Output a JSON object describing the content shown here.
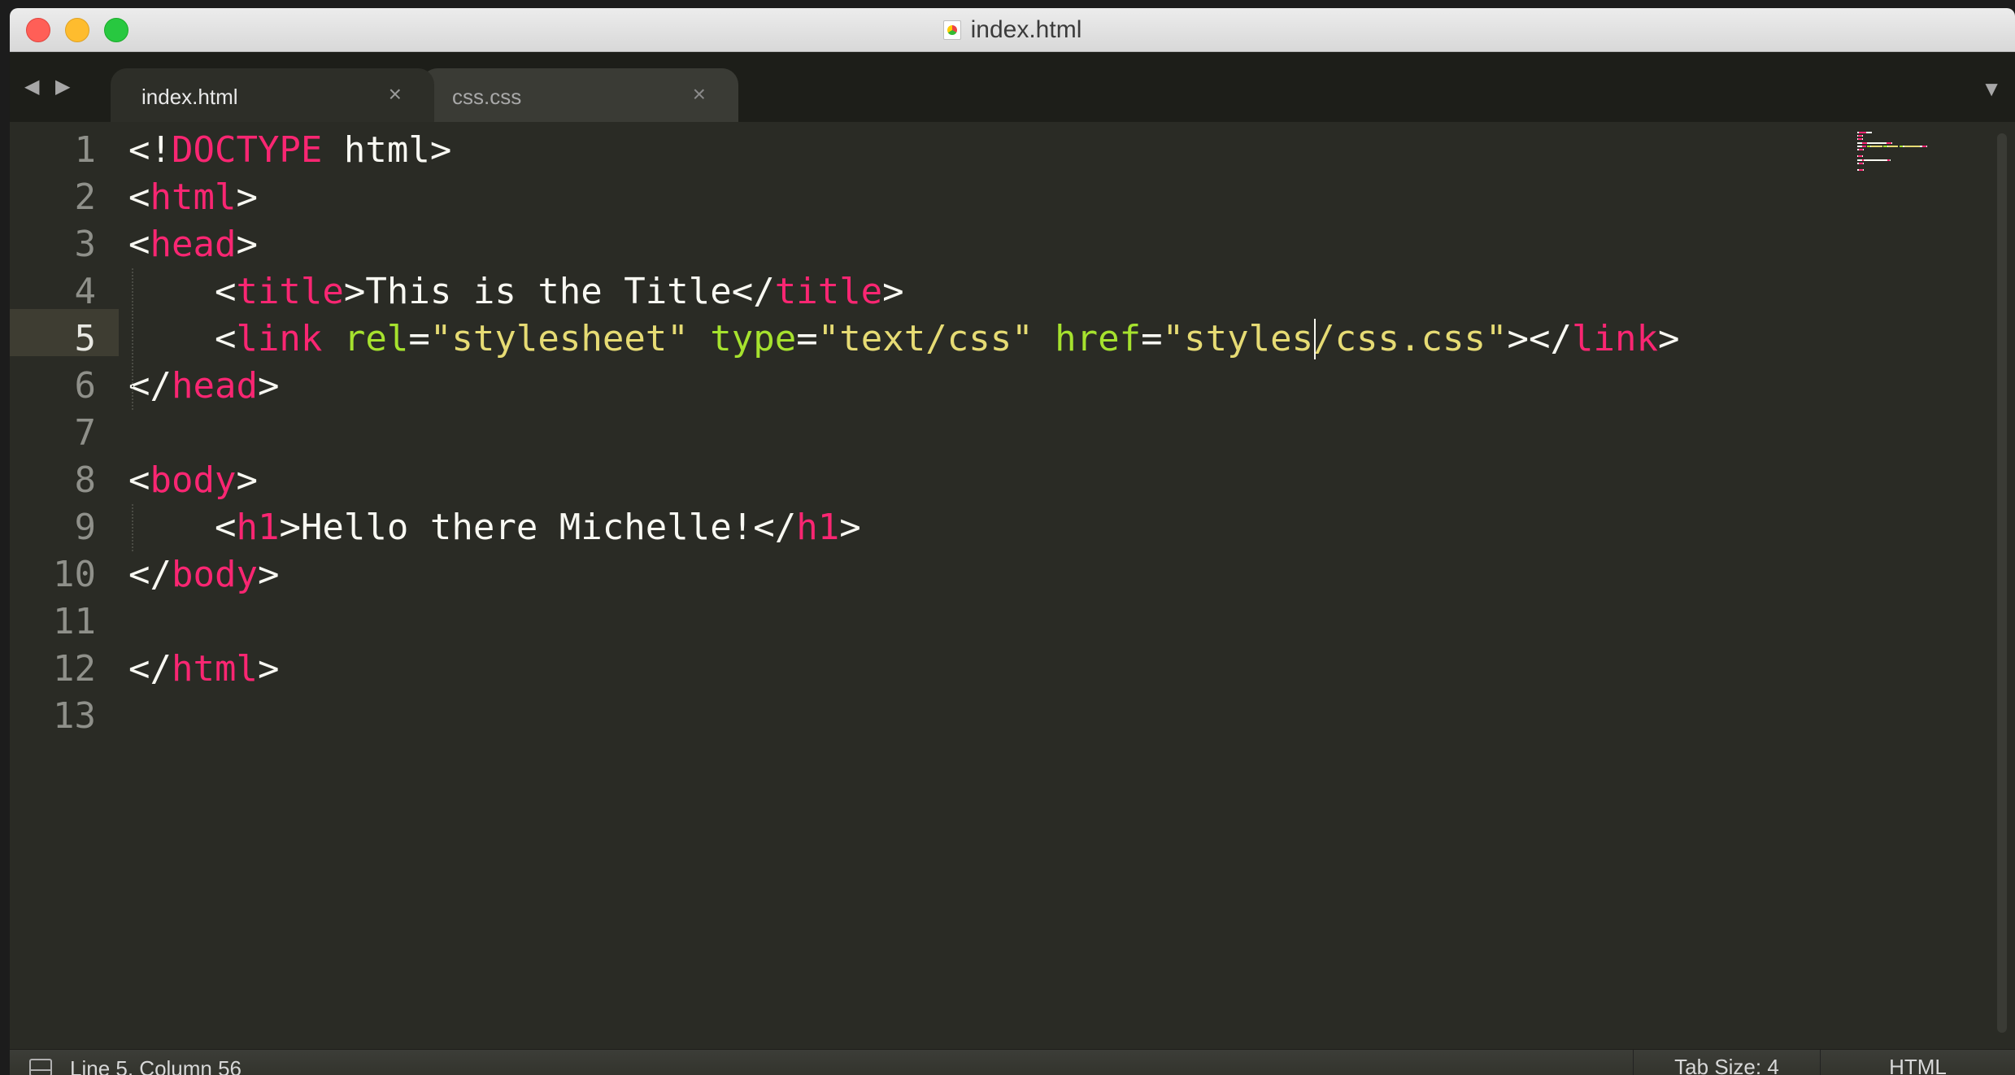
{
  "window": {
    "title": "index.html"
  },
  "tabs": [
    {
      "label": "index.html",
      "close": "×",
      "active": true
    },
    {
      "label": "css.css",
      "close": "×",
      "active": false
    }
  ],
  "nav": {
    "back": "◀",
    "forward": "▶",
    "overflow": "▼"
  },
  "editor": {
    "line_numbers": [
      "1",
      "2",
      "3",
      "4",
      "5",
      "6",
      "7",
      "8",
      "9",
      "10",
      "11",
      "12",
      "13"
    ],
    "active_line": "5",
    "lines": [
      [
        {
          "c": "p",
          "t": "<!"
        },
        {
          "c": "t",
          "t": "DOCTYPE"
        },
        {
          "c": "p",
          "t": " html>"
        }
      ],
      [
        {
          "c": "p",
          "t": "<"
        },
        {
          "c": "t",
          "t": "html"
        },
        {
          "c": "p",
          "t": ">"
        }
      ],
      [
        {
          "c": "p",
          "t": "<"
        },
        {
          "c": "t",
          "t": "head"
        },
        {
          "c": "p",
          "t": ">"
        }
      ],
      [
        {
          "c": "p",
          "t": "    <"
        },
        {
          "c": "t",
          "t": "title"
        },
        {
          "c": "p",
          "t": ">This is the Title</"
        },
        {
          "c": "t",
          "t": "title"
        },
        {
          "c": "p",
          "t": ">"
        }
      ],
      [
        {
          "c": "p",
          "t": "    <"
        },
        {
          "c": "t",
          "t": "link"
        },
        {
          "c": "p",
          "t": " "
        },
        {
          "c": "a",
          "t": "rel"
        },
        {
          "c": "p",
          "t": "="
        },
        {
          "c": "s",
          "t": "\"stylesheet\""
        },
        {
          "c": "p",
          "t": " "
        },
        {
          "c": "a",
          "t": "type"
        },
        {
          "c": "p",
          "t": "="
        },
        {
          "c": "s",
          "t": "\"text/css\""
        },
        {
          "c": "p",
          "t": " "
        },
        {
          "c": "a",
          "t": "href"
        },
        {
          "c": "p",
          "t": "="
        },
        {
          "c": "s",
          "t": "\"styles/css.css\""
        },
        {
          "c": "p",
          "t": "></"
        },
        {
          "c": "t",
          "t": "link"
        },
        {
          "c": "p",
          "t": ">"
        }
      ],
      [
        {
          "c": "p",
          "t": "</"
        },
        {
          "c": "t",
          "t": "head"
        },
        {
          "c": "p",
          "t": ">"
        }
      ],
      [],
      [
        {
          "c": "p",
          "t": "<"
        },
        {
          "c": "t",
          "t": "body"
        },
        {
          "c": "p",
          "t": ">"
        }
      ],
      [
        {
          "c": "p",
          "t": "    <"
        },
        {
          "c": "t",
          "t": "h1"
        },
        {
          "c": "p",
          "t": ">Hello there Michelle!</"
        },
        {
          "c": "t",
          "t": "h1"
        },
        {
          "c": "p",
          "t": ">"
        }
      ],
      [
        {
          "c": "p",
          "t": "</"
        },
        {
          "c": "t",
          "t": "body"
        },
        {
          "c": "p",
          "t": ">"
        }
      ],
      [],
      [
        {
          "c": "p",
          "t": "</"
        },
        {
          "c": "t",
          "t": "html"
        },
        {
          "c": "p",
          "t": ">"
        }
      ],
      []
    ],
    "cursor": {
      "line": 5,
      "column": 56
    }
  },
  "colors": {
    "tag": "#f92672",
    "attribute": "#a6e22e",
    "string": "#e6db74",
    "plain": "#f8f8f2",
    "background": "#2a2b25"
  },
  "status": {
    "position": "Line 5, Column 56",
    "tab_size": "Tab Size: 4",
    "syntax": "HTML"
  }
}
